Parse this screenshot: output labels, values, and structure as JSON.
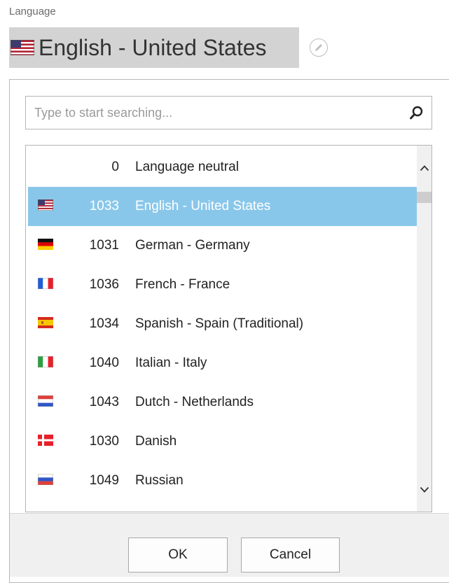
{
  "field": {
    "label": "Language",
    "value": "English - United States",
    "value_flag": "us-flag-icon"
  },
  "search": {
    "placeholder": "Type to start searching...",
    "value": ""
  },
  "languages": [
    {
      "code": "0",
      "name": "Language neutral",
      "flag": "none"
    },
    {
      "code": "1033",
      "name": "English - United States",
      "flag": "us",
      "selected": true
    },
    {
      "code": "1031",
      "name": "German - Germany",
      "flag": "de"
    },
    {
      "code": "1036",
      "name": "French - France",
      "flag": "fr"
    },
    {
      "code": "1034",
      "name": "Spanish - Spain (Traditional)",
      "flag": "es"
    },
    {
      "code": "1040",
      "name": "Italian - Italy",
      "flag": "it"
    },
    {
      "code": "1043",
      "name": "Dutch - Netherlands",
      "flag": "nl"
    },
    {
      "code": "1030",
      "name": "Danish",
      "flag": "dk"
    },
    {
      "code": "1049",
      "name": "Russian",
      "flag": "ru"
    },
    {
      "code": "",
      "name": "",
      "flag": "partial-red"
    }
  ],
  "buttons": {
    "ok": "OK",
    "cancel": "Cancel"
  },
  "colors": {
    "selection": "#89c7ea",
    "field_bg": "#d3d3d3",
    "footer_bg": "#f0f0f0"
  }
}
